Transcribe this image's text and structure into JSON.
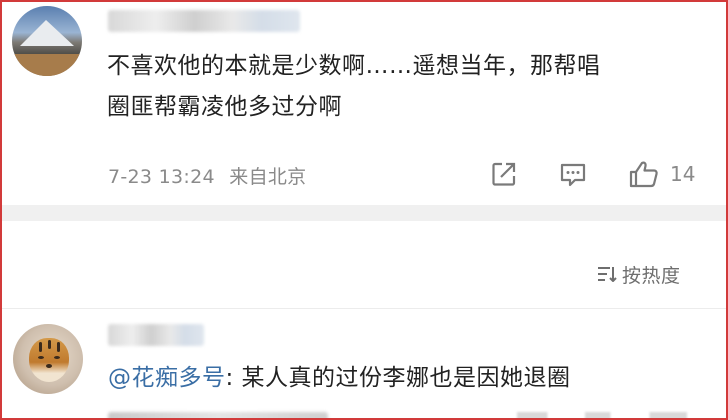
{
  "comments": [
    {
      "username": "",
      "text_line1": "不喜欢他的本就是少数啊……遥想当年，那帮唱",
      "text_line2": "圈匪帮霸凌他多过分啊",
      "time": "7-23 13:24",
      "source": "来自北京",
      "like_count": "14",
      "icons": [
        "share-icon",
        "comment-icon",
        "like-icon"
      ]
    },
    {
      "username": "",
      "mention": "@花痴多号",
      "text": ": 某人真的过份李娜也是因她退圈"
    }
  ],
  "sort": {
    "icon": "sort-icon",
    "label": "按热度"
  },
  "colors": {
    "frame_border": "#d23a3a",
    "mention": "#3a6ea5",
    "meta_text": "#8a8a8a",
    "body_text": "#222222"
  }
}
